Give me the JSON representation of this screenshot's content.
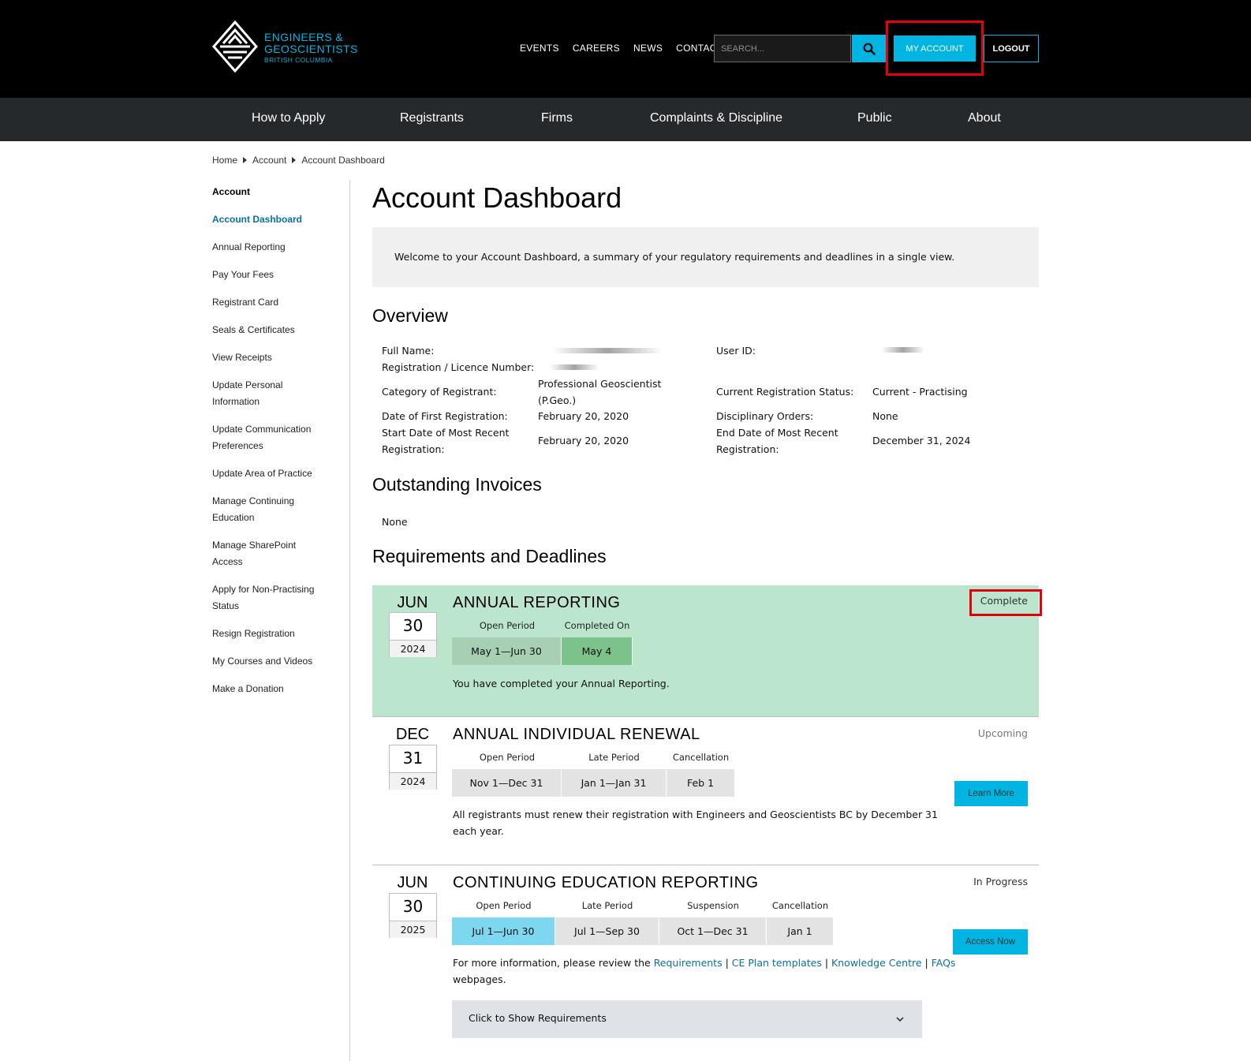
{
  "brand": {
    "line1": "ENGINEERS &",
    "line2": "GEOSCIENTISTS",
    "line3": "BRITISH COLUMBIA",
    "accent": "#00b5e2",
    "highlight": "#e3000f",
    "complete_bg": "#bce5ce"
  },
  "header": {
    "links": [
      "EVENTS",
      "CAREERS",
      "NEWS",
      "CONTACT"
    ],
    "search_placeholder": "SEARCH...",
    "my_account": "MY ACCOUNT",
    "logout": "LOGOUT"
  },
  "mainnav": [
    "How to Apply",
    "Registrants",
    "Firms",
    "Complaints & Discipline",
    "Public",
    "About"
  ],
  "breadcrumb": [
    "Home",
    "Account",
    "Account Dashboard"
  ],
  "sidebar": {
    "heading": "Account",
    "items": [
      "Account Dashboard",
      "Annual Reporting",
      "Pay Your Fees",
      "Registrant Card",
      "Seals & Certificates",
      "View Receipts",
      "Update Personal Information",
      "Update Communication Preferences",
      "Update Area of Practice",
      "Manage Continuing Education",
      "Manage SharePoint Access",
      "Apply for Non-Practising Status",
      "Resign Registration",
      "My Courses and Videos",
      "Make a Donation"
    ]
  },
  "page": {
    "title": "Account Dashboard",
    "welcome": "Welcome to your Account Dashboard, a summary of your regulatory requirements and deadlines in a single view."
  },
  "overview": {
    "heading": "Overview",
    "full_name_label": "Full Name:",
    "reg_number_label": "Registration / Licence Number:",
    "user_id_label": "User ID:",
    "category_label": "Category of Registrant:",
    "category_value": "Professional Geoscientist (P.Geo.)",
    "status_label": "Current Registration Status:",
    "status_value": "Current - Practising",
    "first_reg_label": "Date of First Registration:",
    "first_reg_value": "February 20, 2020",
    "disciplinary_label": "Disciplinary Orders:",
    "disciplinary_value": "None",
    "start_recent_label": "Start Date of Most Recent Registration:",
    "start_recent_value": "February 20, 2020",
    "end_recent_label": "End Date of Most Recent Registration:",
    "end_recent_value": "December 31, 2024"
  },
  "invoices": {
    "heading": "Outstanding Invoices",
    "value": "None"
  },
  "requirements": {
    "heading": "Requirements and Deadlines",
    "annual_reporting": {
      "month": "JUN",
      "day": "30",
      "year": "2024",
      "title": "ANNUAL REPORTING",
      "status": "Complete",
      "labels": [
        "Open Period",
        "Completed On"
      ],
      "segments": [
        "May 1—Jun 30",
        "May 4"
      ],
      "description": "You have completed your Annual Reporting."
    },
    "renewal": {
      "month": "DEC",
      "day": "31",
      "year": "2024",
      "title": "ANNUAL INDIVIDUAL RENEWAL",
      "status": "Upcoming",
      "labels": [
        "Open Period",
        "Late Period",
        "Cancellation"
      ],
      "segments": [
        "Nov 1—Dec 31",
        "Jan 1—Jan 31",
        "Feb 1"
      ],
      "description_line1": "All registrants must renew their registration with Engineers and Geoscientists BC by December 31",
      "description_line2": "each year.",
      "button": "Learn More"
    },
    "ce_reporting": {
      "month": "JUN",
      "day": "30",
      "year": "2025",
      "title": "CONTINUING EDUCATION REPORTING",
      "status": "In Progress",
      "labels": [
        "Open Period",
        "Late Period",
        "Suspension",
        "Cancellation"
      ],
      "segments": [
        "Jul 1—Jun 30",
        "Jul 1—Sep 30",
        "Oct 1—Dec 31",
        "Jan 1"
      ],
      "desc_prefix": "For more information, please review the ",
      "links": [
        "Requirements",
        "CE Plan templates",
        "Knowledge Centre",
        "FAQs"
      ],
      "separator": " | ",
      "desc_suffix": "webpages.",
      "button": "Access Now",
      "expander": "Click to Show Requirements"
    }
  }
}
